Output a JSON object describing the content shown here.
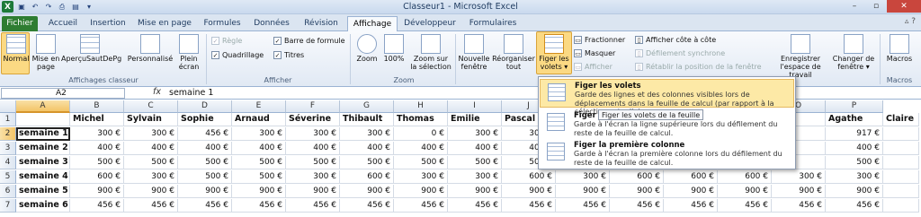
{
  "window": {
    "title": "Classeur1 - Microsoft Excel"
  },
  "qat": {
    "minimize": "–",
    "restore": "▫",
    "close": "✕"
  },
  "tabs": [
    "Fichier",
    "Accueil",
    "Insertion",
    "Mise en page",
    "Formules",
    "Données",
    "Révision",
    "Affichage",
    "Développeur",
    "Formulaires"
  ],
  "ribbon": {
    "classeur": {
      "normal": "Normal",
      "mise_en_page_1": "Mise en",
      "mise_en_page_2": "page",
      "apercu": "AperçuSautDePg",
      "perso": "Personnalisé",
      "plein_1": "Plein",
      "plein_2": "écran",
      "group": "Affichages classeur"
    },
    "afficher": {
      "regle": "Règle",
      "barre_formule": "Barre de formule",
      "quadrillage": "Quadrillage",
      "titres": "Titres",
      "group": "Afficher"
    },
    "zoom": {
      "zoom": "Zoom",
      "zoom100": "100%",
      "zoom_sel_1": "Zoom sur",
      "zoom_sel_2": "la sélection",
      "group": "Zoom"
    },
    "fenetre": {
      "nouvelle_1": "Nouvelle",
      "nouvelle_2": "fenêtre",
      "reorg_1": "Réorganiser",
      "reorg_2": "tout",
      "figer_1": "Figer les",
      "figer_2": "volets",
      "fractionner": "Fractionner",
      "masquer": "Masquer",
      "afficher": "Afficher",
      "cote": "Afficher côte à côte",
      "defil": "Défilement synchrone",
      "retablir": "Rétablir la position de la fenêtre",
      "enreg_1": "Enregistrer",
      "enreg_2": "l'espace de travail",
      "changer_1": "Changer de",
      "changer_2": "fenêtre"
    },
    "macros": {
      "label": "Macros",
      "group": "Macros"
    }
  },
  "formula_bar": {
    "namebox": "A2",
    "fx": "fx",
    "value": "semaine 1"
  },
  "columns": [
    "A",
    "B",
    "C",
    "D",
    "E",
    "F",
    "G",
    "H",
    "I",
    "J",
    "K",
    "L",
    "M",
    "N",
    "O",
    "P"
  ],
  "rows": [
    "1",
    "2",
    "3",
    "4",
    "5",
    "6",
    "7"
  ],
  "header_row": [
    "",
    "Michel",
    "Sylvain",
    "Sophie",
    "Arnaud",
    "Séverine",
    "Thibault",
    "Thomas",
    "Emilie",
    "Pascal",
    "",
    "",
    "",
    "",
    "",
    "Agathe",
    "Claire"
  ],
  "data_rows": [
    {
      "label": "semaine 1",
      "values": [
        "300 €",
        "300 €",
        "456 €",
        "300 €",
        "300 €",
        "300 €",
        "0 €",
        "300 €",
        "300 €",
        "",
        "",
        "",
        "",
        "",
        "917 €"
      ]
    },
    {
      "label": "semaine 2",
      "values": [
        "400 €",
        "400 €",
        "400 €",
        "400 €",
        "400 €",
        "400 €",
        "400 €",
        "400 €",
        "400 €",
        "",
        "",
        "",
        "",
        "",
        "400 €"
      ]
    },
    {
      "label": "semaine 3",
      "values": [
        "500 €",
        "500 €",
        "500 €",
        "500 €",
        "500 €",
        "500 €",
        "500 €",
        "500 €",
        "500 €",
        "",
        "",
        "",
        "",
        "",
        "500 €"
      ]
    },
    {
      "label": "semaine 4",
      "values": [
        "600 €",
        "300 €",
        "500 €",
        "500 €",
        "300 €",
        "600 €",
        "300 €",
        "300 €",
        "600 €",
        "300 €",
        "600 €",
        "600 €",
        "600 €",
        "300 €",
        "300 €"
      ]
    },
    {
      "label": "semaine 5",
      "values": [
        "900 €",
        "900 €",
        "900 €",
        "900 €",
        "900 €",
        "900 €",
        "900 €",
        "900 €",
        "900 €",
        "900 €",
        "900 €",
        "900 €",
        "900 €",
        "900 €",
        "900 €"
      ]
    },
    {
      "label": "semaine 6",
      "values": [
        "456 €",
        "456 €",
        "456 €",
        "456 €",
        "456 €",
        "456 €",
        "456 €",
        "456 €",
        "456 €",
        "456 €",
        "456 €",
        "456 €",
        "456 €",
        "456 €",
        "456 €"
      ]
    }
  ],
  "dropdown": {
    "item1_title": "Figer les volets",
    "item1_desc": "Garde des lignes et des colonnes visibles lors de déplacements dans la feuille de calcul (par rapport à la sélection actuelle).",
    "item2_title": "Figer la",
    "item2_desc": "Garde à l'écran la ligne supérieure lors du défilement du reste de la feuille de calcul.",
    "item3_title": "Figer la première colonne",
    "item3_desc": "Garde à l'écran la première colonne lors du défilement du reste de la feuille de calcul.",
    "tooltip": "Figer les volets de la feuille"
  }
}
